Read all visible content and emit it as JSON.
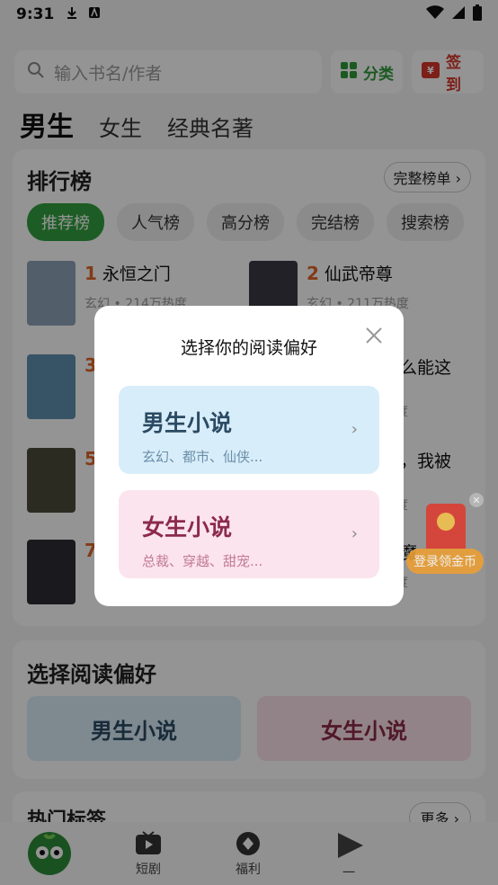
{
  "status": {
    "time": "9:31"
  },
  "search": {
    "placeholder": "输入书名/作者"
  },
  "top_actions": {
    "category": "分类",
    "checkin": "签到"
  },
  "gender_tabs": {
    "male": "男生",
    "female": "女生",
    "classic": "经典名著"
  },
  "ranking": {
    "title": "排行榜",
    "full_list": "完整榜单 ›",
    "tabs": [
      "推荐榜",
      "人气榜",
      "高分榜",
      "完结榜",
      "搜索榜"
    ],
    "books": [
      {
        "rank": "1",
        "title": "永恒之门",
        "meta": "玄幻 • 214万热度",
        "cover": "#8fa3b8"
      },
      {
        "rank": "2",
        "title": "仙武帝尊",
        "meta": "玄幻 • 211万热度",
        "cover": "#3a3a44"
      },
      {
        "rank": "3",
        "title": "",
        "meta": "",
        "cover": "#5f8fb0"
      },
      {
        "rank": "",
        "title": "怎么能这",
        "meta": "热度",
        "cover": ""
      },
      {
        "rank": "5",
        "title": "",
        "meta": "",
        "cover": "#4a4a3c"
      },
      {
        "rank": "",
        "title": "兽，我被",
        "meta": "热度",
        "cover": ""
      },
      {
        "rank": "7",
        "title": "",
        "meta": "",
        "cover": "#2c2c34"
      },
      {
        "rank": "",
        "title": "大魔",
        "meta": "热度",
        "cover": ""
      }
    ]
  },
  "preference": {
    "title": "选择阅读偏好",
    "male": "男生小说",
    "female": "女生小说"
  },
  "tags": {
    "title": "热门标签",
    "more": "更多 ›"
  },
  "nav": {
    "drama": "短剧",
    "welfare": "福利",
    "other": "一"
  },
  "float_ad": {
    "label": "登录领金币"
  },
  "modal": {
    "title": "选择你的阅读偏好",
    "male_title": "男生小说",
    "male_sub": "玄幻、都市、仙侠...",
    "female_title": "女生小说",
    "female_sub": "总裁、穿越、甜宠..."
  },
  "colors": {
    "accent_green": "#33a040",
    "rank_orange": "#e0662a",
    "ad_orange": "#f0a030"
  }
}
